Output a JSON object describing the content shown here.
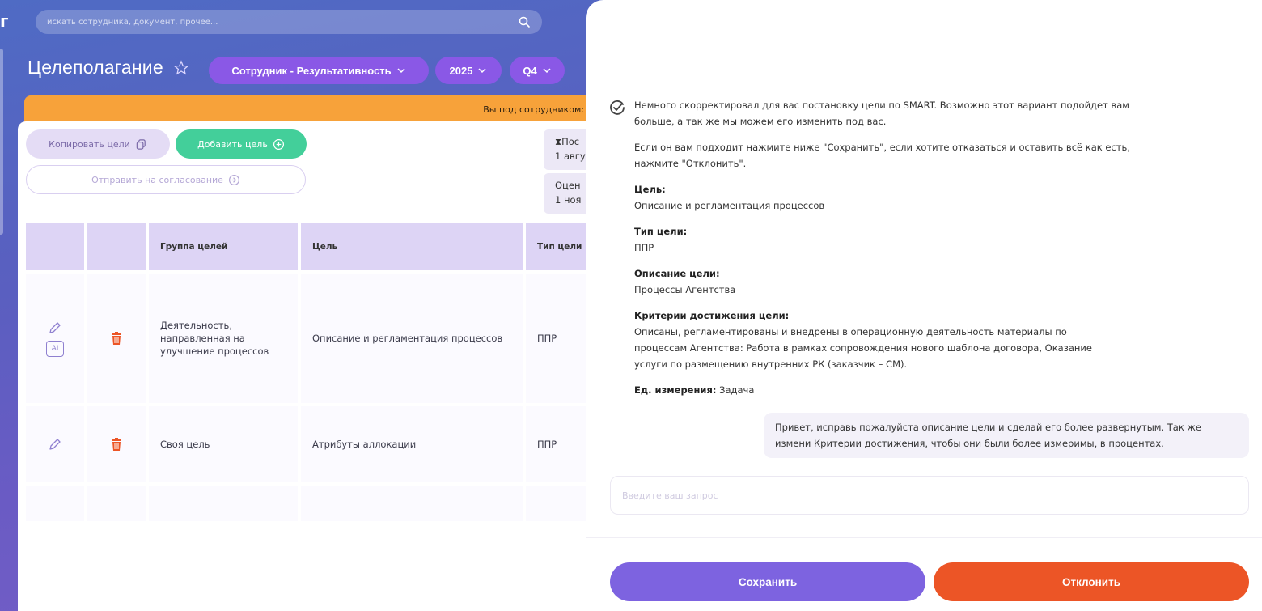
{
  "app": {
    "logo_text": "г"
  },
  "search": {
    "placeholder": "искать сотрудника, документ, прочее..."
  },
  "header": {
    "title": "Целеполагание",
    "filters": [
      {
        "label": "Сотрудник - Результативность"
      },
      {
        "label": "2025"
      },
      {
        "label": "Q4"
      }
    ]
  },
  "banner": {
    "text": "Вы под сотрудником:"
  },
  "actions": {
    "copy_label": "Копировать цели",
    "add_label": "Добавить цель",
    "send_label": "Отправить на согласование"
  },
  "info_cards": [
    {
      "line1": "⧗Пос",
      "line2": "1 авгу"
    },
    {
      "line1": "Оцен",
      "line2": "1 ноя"
    }
  ],
  "table": {
    "columns": [
      "",
      "",
      "Группа целей",
      "Цель",
      "Тип цели"
    ],
    "rows": [
      {
        "group": "Деятельность, направленная на улучшение процессов",
        "goal": "Описание и регламентация процессов",
        "type": "ППР",
        "ai_badge": "AI"
      },
      {
        "group": "Своя цель",
        "goal": "Атрибуты аллокации",
        "type": "ППР"
      }
    ]
  },
  "chat": {
    "ai_intro": "Немного скорректировал для вас постановку цели по SMART. Возможно этот вариант подойдет вам больше, а так же мы можем его изменить под вас.",
    "ai_instruction": "Если он вам подходит нажмите ниже \"Сохранить\", если хотите отказаться и оставить всё как есть, нажмите \"Отклонить\".",
    "goal_label": "Цель:",
    "goal_value": "Описание и регламентация процессов",
    "type_label": "Тип цели:",
    "type_value": "ППР",
    "desc_label": "Описание цели:",
    "desc_value": "Процессы Агентства",
    "criteria_label": "Критерии достижения цели:",
    "criteria_value": "Описаны, регламентированы и внедрены в операционную деятельность материалы по процессам Агентства: Работа в рамках сопровождения нового шаблона договора, Оказание услуги по размещению внутренних РК (заказчик – СМ).",
    "unit_label": "Ед. измерения:",
    "unit_value": "Задача",
    "user_message": "Привет, исправь пожалуйста описание цели и сделай его более развернутым. Так же измени Критерии достижения, чтобы они были более измеримы, в процентах.",
    "input_placeholder": "Введите ваш запрос"
  },
  "panel_actions": {
    "save_label": "Сохранить",
    "reject_label": "Отклонить"
  },
  "colors": {
    "accent": "#7d63e0",
    "danger": "#ec5526",
    "success": "#43cf9a",
    "warning": "#f7a23a"
  }
}
